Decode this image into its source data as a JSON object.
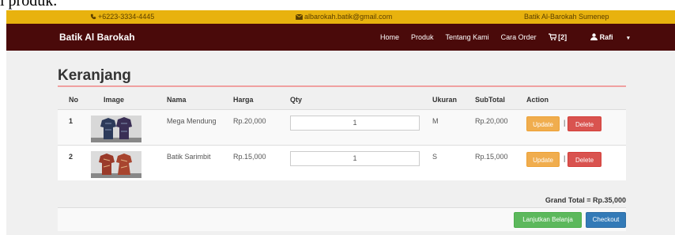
{
  "caption": "i produk.",
  "topbar": {
    "phone": "+6223-3334-4445",
    "email": "albarokah.batik@gmail.com",
    "shop": "Batik Al-Barokah Sumenep"
  },
  "navbar": {
    "brand": "Batik Al Barokah",
    "items": [
      "Home",
      "Produk",
      "Tentang Kami",
      "Cara Order"
    ],
    "cart": "[2]",
    "user": "Rafi"
  },
  "page": {
    "title": "Keranjang"
  },
  "table": {
    "headers": [
      "No",
      "Image",
      "Nama",
      "Harga",
      "Qty",
      "Ukuran",
      "SubTotal",
      "Action"
    ],
    "rows": [
      {
        "no": "1",
        "nama": "Mega Mendung",
        "harga": "Rp.20,000",
        "qty": "1",
        "ukuran": "M",
        "subtotal": "Rp.20,000",
        "update": "Update",
        "sep": "|",
        "delete": "Delete"
      },
      {
        "no": "2",
        "nama": "Batik Sarimbit",
        "harga": "Rp.15,000",
        "qty": "1",
        "ukuran": "S",
        "subtotal": "Rp.15,000",
        "update": "Update",
        "sep": "|",
        "delete": "Delete"
      }
    ]
  },
  "summary": {
    "grand_total": "Grand Total = Rp.35,000",
    "lanjut": "Lanjutkan Belanja",
    "checkout": "Checkout"
  },
  "colors": {
    "topbar": "#e8b20e",
    "navbar": "#4a0a0a",
    "update": "#f0ad4e",
    "delete": "#d9534f",
    "lanjut": "#5cb85c",
    "checkout": "#337ab7"
  }
}
